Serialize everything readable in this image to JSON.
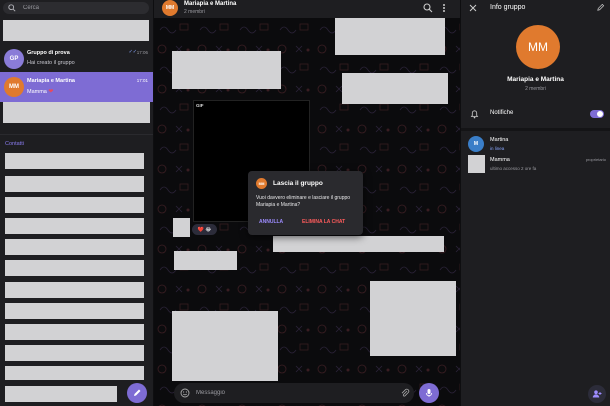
{
  "search": {
    "placeholder": "Cerca"
  },
  "chats": [
    {
      "initials": "GP",
      "name": "Gruppo di prova",
      "preview": "Hai creato il gruppo",
      "time": "17:06",
      "avatar_color": "#8a7cd8"
    },
    {
      "initials": "MM",
      "name": "Mariapia e Martina",
      "preview": "Mamma",
      "time": "17:01",
      "avatar_color": "#e07a2e"
    }
  ],
  "contacts_label": "Contatti",
  "header": {
    "initials": "MM",
    "title": "Mariapia e Martina",
    "subtitle": "2 membri"
  },
  "gif_label": "GIF",
  "reaction": "❤️ 😂",
  "composer": {
    "placeholder": "Messaggio"
  },
  "dialog": {
    "initials": "MM",
    "title": "Lascia il gruppo",
    "body": "Vuoi davvero eliminare e lasciare il gruppo Mariapia e Martina?",
    "cancel": "ANNULLA",
    "confirm": "ELIMINA LA CHAT"
  },
  "info": {
    "title": "Info gruppo",
    "initials": "MM",
    "name": "Mariapia e Martina",
    "members_count": "2 membri",
    "notifications_label": "Notifiche",
    "notifications_on": true,
    "members": [
      {
        "initials": "M",
        "name": "Martina",
        "status": "in linea",
        "role": "",
        "avatar_color": "#3a7ec8"
      },
      {
        "initials": "",
        "name": "Mamma",
        "status": "ultimo accesso 2 ore fa",
        "role": "proprietario",
        "avatar_color": "#d2d2d4"
      }
    ]
  },
  "colors": {
    "accent": "#7e6cd4",
    "danger": "#ff5c5c",
    "panel": "#1e1e21",
    "chat_bg": "#0b0b0d"
  }
}
